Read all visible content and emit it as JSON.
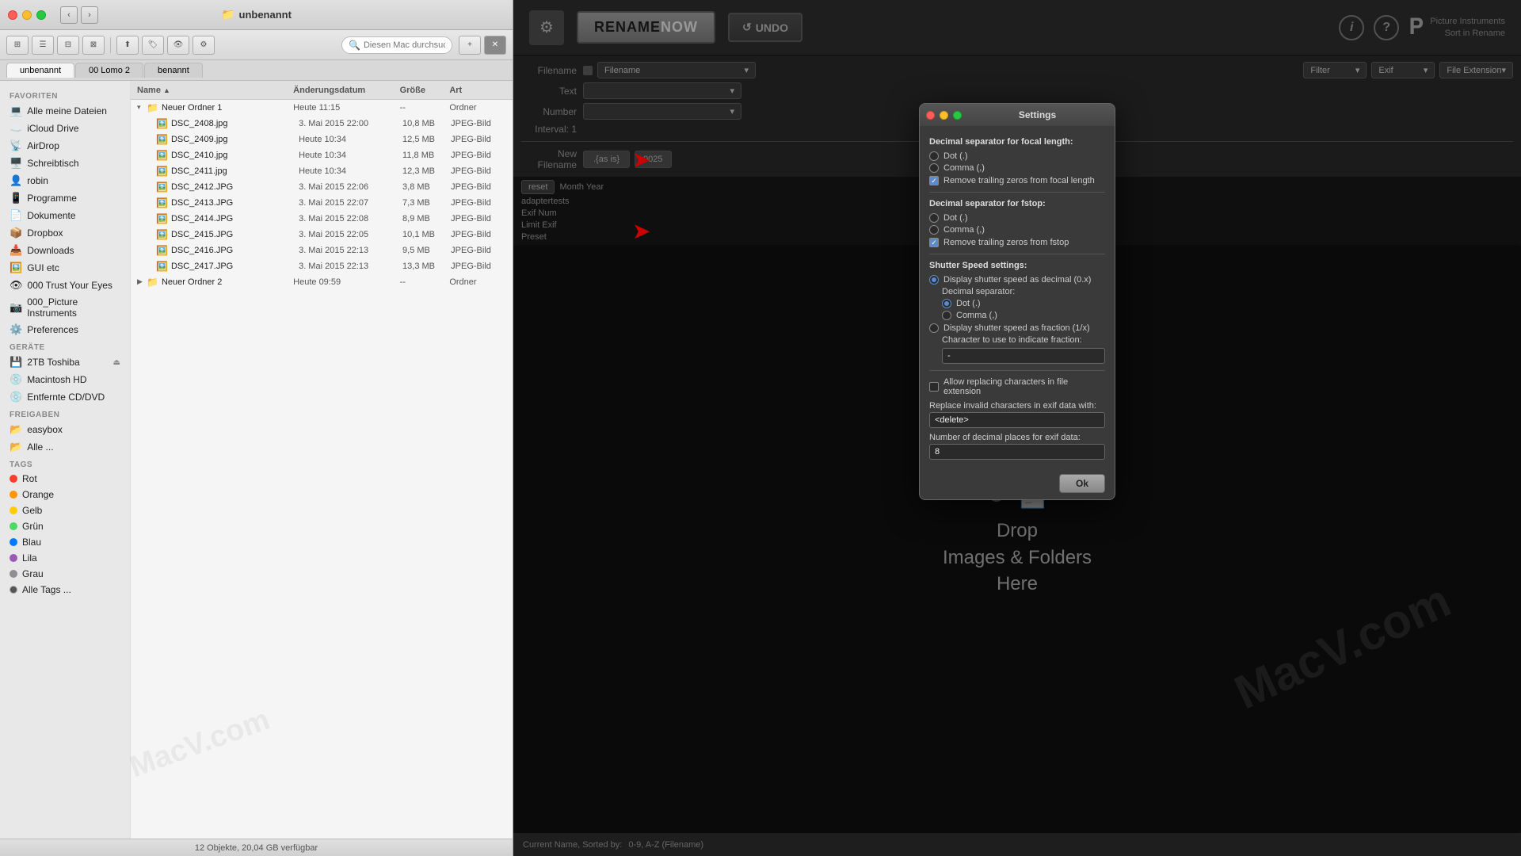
{
  "finder": {
    "title": "unbenannt",
    "tabs": [
      "unbenannt",
      "00 Lomo 2",
      "benannt"
    ],
    "search_placeholder": "Diesen Mac durchsuchen",
    "columns": {
      "name": "Name",
      "date": "Änderungsdatum",
      "size": "Größe",
      "kind": "Art"
    },
    "sidebar": {
      "favorites_label": "Favoriten",
      "items": [
        {
          "icon": "💻",
          "label": "Alle meine Dateien"
        },
        {
          "icon": "☁️",
          "label": "iCloud Drive"
        },
        {
          "icon": "📡",
          "label": "AirDrop"
        },
        {
          "icon": "🖥️",
          "label": "Schreibtisch"
        },
        {
          "icon": "👤",
          "label": "robin"
        },
        {
          "icon": "📱",
          "label": "Programme"
        },
        {
          "icon": "📄",
          "label": "Dokumente"
        },
        {
          "icon": "📦",
          "label": "Dropbox"
        },
        {
          "icon": "📥",
          "label": "Downloads"
        }
      ],
      "gui_item": "GUI etc",
      "trust_item": "000 Trust Your Eyes",
      "pi_item": "000_Picture Instruments",
      "prefs_item": "Preferences",
      "devices_label": "Geräte",
      "devices": [
        {
          "icon": "💾",
          "label": "2TB Toshiba"
        },
        {
          "icon": "💿",
          "label": "Macintosh HD"
        },
        {
          "icon": "💿",
          "label": "Entfernte CD/DVD"
        }
      ],
      "shared_label": "Freigaben",
      "shared": [
        {
          "icon": "📂",
          "label": "easybox"
        },
        {
          "icon": "📂",
          "label": "Alle ..."
        }
      ],
      "tags_label": "Tags",
      "tags": [
        {
          "color": "#ff3b30",
          "label": "Rot"
        },
        {
          "color": "#ff9500",
          "label": "Orange"
        },
        {
          "color": "#ffcc00",
          "label": "Gelb"
        },
        {
          "color": "#4cd964",
          "label": "Grün"
        },
        {
          "color": "#007aff",
          "label": "Blau"
        },
        {
          "color": "#9b59b6",
          "label": "Lila"
        },
        {
          "color": "#8e8e93",
          "label": "Grau"
        },
        {
          "color": "#555",
          "label": "Alle Tags ..."
        }
      ]
    },
    "files": [
      {
        "indent": 0,
        "expanded": true,
        "type": "folder",
        "name": "Neuer Ordner 1",
        "date": "Heute 11:15",
        "size": "--",
        "kind": "Ordner"
      },
      {
        "indent": 1,
        "type": "jpeg",
        "name": "DSC_2408.jpg",
        "date": "3. Mai 2015 22:00",
        "size": "10,8 MB",
        "kind": "JPEG-Bild"
      },
      {
        "indent": 1,
        "type": "jpeg",
        "name": "DSC_2409.jpg",
        "date": "Heute 10:34",
        "size": "12,5 MB",
        "kind": "JPEG-Bild"
      },
      {
        "indent": 1,
        "type": "jpeg",
        "name": "DSC_2410.jpg",
        "date": "Heute 10:34",
        "size": "11,8 MB",
        "kind": "JPEG-Bild"
      },
      {
        "indent": 1,
        "type": "jpeg",
        "name": "DSC_2411.jpg",
        "date": "Heute 10:34",
        "size": "12,3 MB",
        "kind": "JPEG-Bild"
      },
      {
        "indent": 1,
        "type": "jpeg",
        "name": "DSC_2412.JPG",
        "date": "3. Mai 2015 22:06",
        "size": "3,8 MB",
        "kind": "JPEG-Bild"
      },
      {
        "indent": 1,
        "type": "jpeg",
        "name": "DSC_2413.JPG",
        "date": "3. Mai 2015 22:07",
        "size": "7,3 MB",
        "kind": "JPEG-Bild"
      },
      {
        "indent": 1,
        "type": "jpeg",
        "name": "DSC_2414.JPG",
        "date": "3. Mai 2015 22:08",
        "size": "8,9 MB",
        "kind": "JPEG-Bild"
      },
      {
        "indent": 1,
        "type": "jpeg",
        "name": "DSC_2415.JPG",
        "date": "3. Mai 2015 22:05",
        "size": "10,1 MB",
        "kind": "JPEG-Bild"
      },
      {
        "indent": 1,
        "type": "jpeg",
        "name": "DSC_2416.JPG",
        "date": "3. Mai 2015 22:13",
        "size": "9,5 MB",
        "kind": "JPEG-Bild"
      },
      {
        "indent": 1,
        "type": "jpeg",
        "name": "DSC_2417.JPG",
        "date": "3. Mai 2015 22:13",
        "size": "13,3 MB",
        "kind": "JPEG-Bild"
      },
      {
        "indent": 0,
        "expanded": false,
        "type": "folder",
        "name": "Neuer Ordner 2",
        "date": "Heute 09:59",
        "size": "--",
        "kind": "Ordner"
      }
    ],
    "statusbar": "12 Objekte, 20,04 GB verfügbar"
  },
  "app": {
    "rename_now_label": "RENAME NOW",
    "undo_label": "UNDO",
    "pi_brand": "Picture Instruments\nSort in Rename",
    "drop_text": "Drop\nImages & Folders\nHere",
    "rows": {
      "filename_label": "Filename",
      "text_label": "Text",
      "number_label": "Number",
      "interval_label": "Interval: 1",
      "new_filename_label": "New Filename",
      "as_is_btn": ".{as is}",
      "counter_btn": "0025"
    },
    "right_dropdowns": {
      "filter_label": "Filter",
      "exif_label": "Exif",
      "extension_label": "File Extension"
    },
    "preset_area": {
      "reset_label": "reset",
      "month_year": "Month Year",
      "adaptertests": "adaptertests",
      "exif_num": "Exif Num",
      "limit_exif": "Limit Exif",
      "preset_label": "Preset"
    },
    "bottom_bar": {
      "current_name_label": "Current Name, Sorted by:",
      "sorted_value": "0-9, A-Z (Filename)"
    }
  },
  "settings_dialog": {
    "title": "Settings",
    "focal_length_section": "Decimal separator for focal length:",
    "focal_dot": "Dot (.)",
    "focal_comma": "Comma (,)",
    "focal_trailing": "Remove trailing zeros from focal length",
    "focal_trailing_checked": true,
    "fstop_section": "Decimal separator for fstop:",
    "fstop_dot": "Dot (.)",
    "fstop_comma": "Comma (,)",
    "fstop_trailing": "Remove trailing zeros from fstop",
    "fstop_trailing_checked": true,
    "shutter_section": "Shutter Speed settings:",
    "shutter_decimal_label": "Display shutter speed as decimal (0.x)",
    "decimal_sep_label": "Decimal separator:",
    "shutter_dot": "Dot (.)",
    "shutter_comma": "Comma (,)",
    "shutter_fraction_label": "Display shutter speed as fraction (1/x)",
    "fraction_char_label": "Character to use to indicate fraction:",
    "fraction_char_value": "-",
    "allow_replace_label": "Allow replacing characters in file extension",
    "replace_invalid_label": "Replace invalid characters in exif data with:",
    "replace_invalid_value": "<delete>",
    "decimal_places_label": "Number of decimal places for exif data:",
    "decimal_places_value": "8",
    "ok_label": "Ok"
  },
  "watermark": "MacV.com"
}
